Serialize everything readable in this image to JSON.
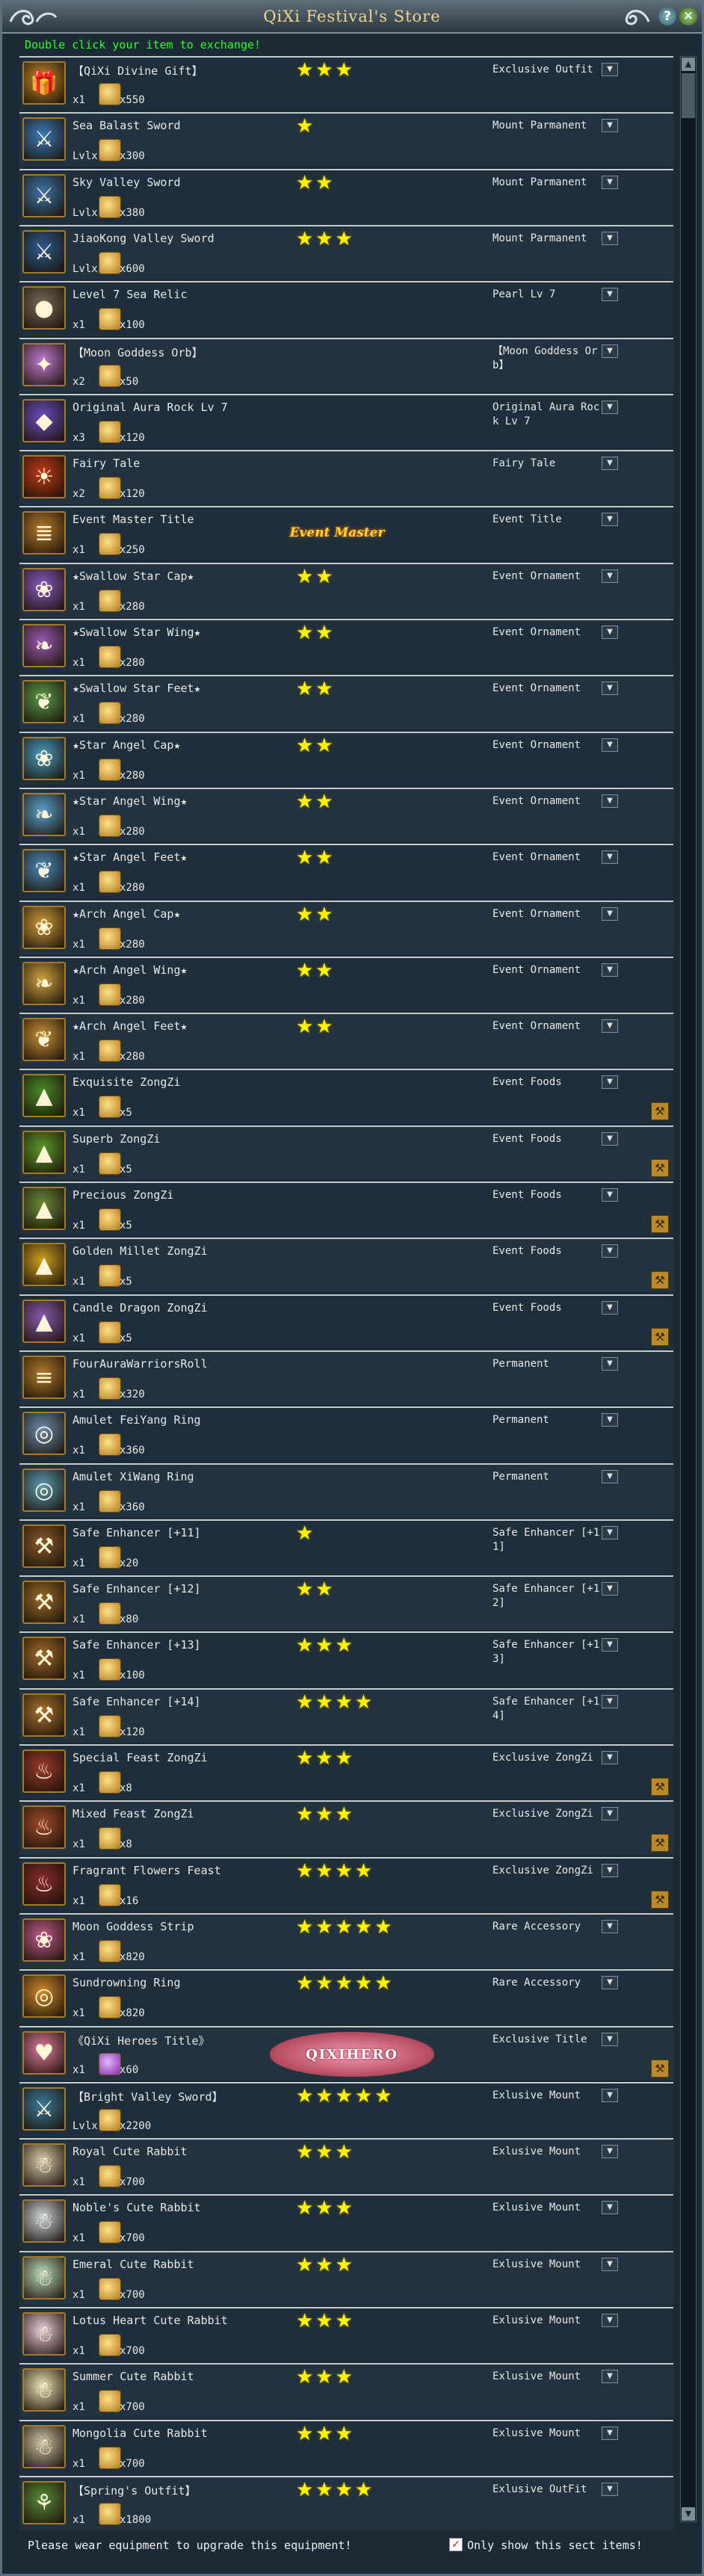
{
  "window": {
    "title": "QiXi Festival's Store",
    "hint": "Double click your item to exchange!",
    "help_label": "?",
    "close_label": "✕"
  },
  "footer": {
    "hint": "Please wear equipment to upgrade this equipment!",
    "only_show_label": "Only show this sect items!",
    "only_show_checked": true
  },
  "items": [
    {
      "name": "【QiXi Divine Gift】",
      "qty": "x1",
      "price": "x550",
      "stars": 3,
      "category": "Exclusive Outfit",
      "icon": "gift-box-icon",
      "color": "#c88a2a"
    },
    {
      "name": "Sea Balast Sword",
      "qty": "Lvlx1",
      "price": "x300",
      "stars": 1,
      "category": "Mount Parmanent",
      "icon": "sword-icon",
      "color": "#3b7ab8"
    },
    {
      "name": "Sky Valley Sword",
      "qty": "Lvlx1",
      "price": "x380",
      "stars": 2,
      "category": "Mount Parmanent",
      "icon": "sword-icon",
      "color": "#3c74a8"
    },
    {
      "name": "JiaoKong Valley Sword",
      "qty": "Lvlx1",
      "price": "x600",
      "stars": 3,
      "category": "Mount Parmanent",
      "icon": "sword-icon",
      "color": "#2e5b8f"
    },
    {
      "name": "Level 7 Sea Relic",
      "qty": "x1",
      "price": "x100",
      "stars": 0,
      "category": "Pearl Lv 7",
      "icon": "pearl-icon",
      "color": "#7a6b5b"
    },
    {
      "name": "【Moon Goddess Orb】",
      "qty": "x2",
      "price": "x50",
      "stars": 0,
      "category": "【Moon Goddess Orb】",
      "icon": "orb-icon",
      "color": "#c27ad0"
    },
    {
      "name": "Original Aura Rock Lv 7",
      "qty": "x3",
      "price": "x120",
      "stars": 0,
      "category": "Original Aura Rock Lv 7",
      "icon": "aura-rock-icon",
      "color": "#6a4ec0"
    },
    {
      "name": "Fairy Tale",
      "qty": "x2",
      "price": "x120",
      "stars": 0,
      "category": "Fairy Tale",
      "icon": "fire-orb-icon",
      "color": "#c03a18"
    },
    {
      "name": "Event Master Title",
      "qty": "x1",
      "price": "x250",
      "stars": 0,
      "category": "Event Title",
      "icon": "scroll-icon",
      "color": "#b57a2a",
      "badge": "Event Master"
    },
    {
      "name": "★Swallow Star Cap★",
      "qty": "x1",
      "price": "x280",
      "stars": 2,
      "category": "Event Ornament",
      "icon": "cap-icon",
      "color": "#8a5ac0"
    },
    {
      "name": "★Swallow Star Wing★",
      "qty": "x1",
      "price": "x280",
      "stars": 2,
      "category": "Event Ornament",
      "icon": "wing-icon",
      "color": "#9a5ab0"
    },
    {
      "name": "★Swallow Star Feet★",
      "qty": "x1",
      "price": "x280",
      "stars": 2,
      "category": "Event Ornament",
      "icon": "feet-icon",
      "color": "#5a9a4a"
    },
    {
      "name": "★Star Angel Cap★",
      "qty": "x1",
      "price": "x280",
      "stars": 2,
      "category": "Event Ornament",
      "icon": "cap-icon",
      "color": "#4a9ac0"
    },
    {
      "name": "★Star Angel Wing★",
      "qty": "x1",
      "price": "x280",
      "stars": 2,
      "category": "Event Ornament",
      "icon": "wing-icon",
      "color": "#5aa0c8"
    },
    {
      "name": "★Star Angel Feet★",
      "qty": "x1",
      "price": "x280",
      "stars": 2,
      "category": "Event Ornament",
      "icon": "feet-icon",
      "color": "#4a8ab8"
    },
    {
      "name": "★Arch Angel Cap★",
      "qty": "x1",
      "price": "x280",
      "stars": 2,
      "category": "Event Ornament",
      "icon": "cap-icon",
      "color": "#d09a3a"
    },
    {
      "name": "★Arch Angel Wing★",
      "qty": "x1",
      "price": "x280",
      "stars": 2,
      "category": "Event Ornament",
      "icon": "wing-icon",
      "color": "#d0a040"
    },
    {
      "name": "★Arch Angel Feet★",
      "qty": "x1",
      "price": "x280",
      "stars": 2,
      "category": "Event Ornament",
      "icon": "feet-icon",
      "color": "#c89038"
    },
    {
      "name": "Exquisite ZongZi",
      "qty": "x1",
      "price": "x5",
      "stars": 0,
      "category": "Event Foods",
      "icon": "zongzi-icon",
      "color": "#4a8a2a",
      "upgrade": true
    },
    {
      "name": "Superb ZongZi",
      "qty": "x1",
      "price": "x5",
      "stars": 0,
      "category": "Event Foods",
      "icon": "zongzi-icon",
      "color": "#5a9a2a",
      "upgrade": true
    },
    {
      "name": "Precious ZongZi",
      "qty": "x1",
      "price": "x5",
      "stars": 0,
      "category": "Event Foods",
      "icon": "zongzi-icon",
      "color": "#6a8a3a",
      "upgrade": true
    },
    {
      "name": "Golden Millet ZongZi",
      "qty": "x1",
      "price": "x5",
      "stars": 0,
      "category": "Event Foods",
      "icon": "zongzi-icon",
      "color": "#d0a020",
      "upgrade": true
    },
    {
      "name": "Candle Dragon ZongZi",
      "qty": "x1",
      "price": "x5",
      "stars": 0,
      "category": "Event Foods",
      "icon": "zongzi-icon",
      "color": "#8a5ab0",
      "upgrade": true
    },
    {
      "name": "FourAuraWarriorsRoll",
      "qty": "x1",
      "price": "x320",
      "stars": 0,
      "category": "Permanent",
      "icon": "roll-icon",
      "color": "#b07a2a"
    },
    {
      "name": "Amulet FeiYang Ring",
      "qty": "x1",
      "price": "x360",
      "stars": 0,
      "category": "Permanent",
      "icon": "ring-icon",
      "color": "#6a8ab0"
    },
    {
      "name": "Amulet XiWang Ring",
      "qty": "x1",
      "price": "x360",
      "stars": 0,
      "category": "Permanent",
      "icon": "ring-icon",
      "color": "#5a9ab0"
    },
    {
      "name": "Safe Enhancer [+11]",
      "qty": "x1",
      "price": "x20",
      "stars": 1,
      "category": "Safe Enhancer [+11]",
      "icon": "enhancer-icon",
      "color": "#8a5a2a"
    },
    {
      "name": "Safe Enhancer [+12]",
      "qty": "x1",
      "price": "x80",
      "stars": 2,
      "category": "Safe Enhancer [+12]",
      "icon": "enhancer-icon",
      "color": "#9a6a2a"
    },
    {
      "name": "Safe Enhancer [+13]",
      "qty": "x1",
      "price": "x100",
      "stars": 3,
      "category": "Safe Enhancer [+13]",
      "icon": "enhancer-icon",
      "color": "#a06a2a"
    },
    {
      "name": "Safe Enhancer [+14]",
      "qty": "x1",
      "price": "x120",
      "stars": 4,
      "category": "Safe Enhancer [+14]",
      "icon": "enhancer-icon",
      "color": "#a87030"
    },
    {
      "name": "Special Feast ZongZi",
      "qty": "x1",
      "price": "x8",
      "stars": 3,
      "category": "Exclusive ZongZi",
      "icon": "feast-icon",
      "color": "#9a3a2a",
      "upgrade": true
    },
    {
      "name": "Mixed Feast ZongZi",
      "qty": "x1",
      "price": "x8",
      "stars": 3,
      "category": "Exclusive ZongZi",
      "icon": "feast-icon",
      "color": "#a04a2a",
      "upgrade": true
    },
    {
      "name": "Fragrant Flowers Feast",
      "qty": "x1",
      "price": "x16",
      "stars": 4,
      "category": "Exclusive ZongZi",
      "icon": "feast-icon",
      "color": "#8a2a2a",
      "upgrade": true
    },
    {
      "name": "Moon Goddess Strip",
      "qty": "x1",
      "price": "x820",
      "stars": 5,
      "category": "Rare Accessory",
      "icon": "strip-icon",
      "color": "#c05a8a"
    },
    {
      "name": "Sundrowning Ring",
      "qty": "x1",
      "price": "x820",
      "stars": 5,
      "category": "Rare Accessory",
      "icon": "ring-icon",
      "color": "#d08a2a"
    },
    {
      "name": "《QiXi Heroes Title》",
      "qty": "x1",
      "price": "x60",
      "stars": 0,
      "category": "Exclusive Title",
      "icon": "heart-icon",
      "color": "#e07a9a",
      "badge": "QIXIHERO",
      "coin": "purple",
      "upgrade": true
    },
    {
      "name": "【Bright Valley Sword】",
      "qty": "Lvlx1",
      "price": "x2200",
      "stars": 5,
      "category": "Exlusive Mount",
      "icon": "sword-icon",
      "color": "#3a7a9a"
    },
    {
      "name": "Royal Cute Rabbit",
      "qty": "x1",
      "price": "x700",
      "stars": 3,
      "category": "Exlusive Mount",
      "icon": "rabbit-icon",
      "color": "#d8c8a8"
    },
    {
      "name": "Noble's Cute Rabbit",
      "qty": "x1",
      "price": "x700",
      "stars": 3,
      "category": "Exlusive Mount",
      "icon": "rabbit-icon",
      "color": "#c8d0d8"
    },
    {
      "name": "Emeral Cute Rabbit",
      "qty": "x1",
      "price": "x700",
      "stars": 3,
      "category": "Exlusive Mount",
      "icon": "rabbit-icon",
      "color": "#b8d8b8"
    },
    {
      "name": "Lotus Heart Cute Rabbit",
      "qty": "x1",
      "price": "x700",
      "stars": 3,
      "category": "Exlusive Mount",
      "icon": "rabbit-icon",
      "color": "#e8c8d8"
    },
    {
      "name": "Summer Cute Rabbit",
      "qty": "x1",
      "price": "x700",
      "stars": 3,
      "category": "Exlusive Mount",
      "icon": "rabbit-icon",
      "color": "#e8e0b0"
    },
    {
      "name": "Mongolia Cute Rabbit",
      "qty": "x1",
      "price": "x700",
      "stars": 3,
      "category": "Exlusive Mount",
      "icon": "rabbit-icon",
      "color": "#c8c0a0"
    },
    {
      "name": "【Spring's Outfit】",
      "qty": "x1",
      "price": "x1800",
      "stars": 4,
      "category": "Exlusive OutFit",
      "icon": "outfit-icon",
      "color": "#5a8a3a"
    }
  ],
  "icon_glyphs": {
    "gift-box-icon": "🎁",
    "sword-icon": "⚔",
    "pearl-icon": "●",
    "orb-icon": "✦",
    "aura-rock-icon": "◆",
    "fire-orb-icon": "☀",
    "scroll-icon": "≣",
    "cap-icon": "❀",
    "wing-icon": "❧",
    "feet-icon": "❦",
    "zongzi-icon": "▲",
    "roll-icon": "≡",
    "ring-icon": "◎",
    "enhancer-icon": "⚒",
    "feast-icon": "♨",
    "strip-icon": "❀",
    "heart-icon": "♥",
    "rabbit-icon": "☃",
    "outfit-icon": "⚘"
  },
  "dropdown_glyph": "▼",
  "upgrade_glyph": "⚒",
  "star_glyph": "★",
  "scroll": {
    "up": "▲",
    "down": "▼"
  }
}
